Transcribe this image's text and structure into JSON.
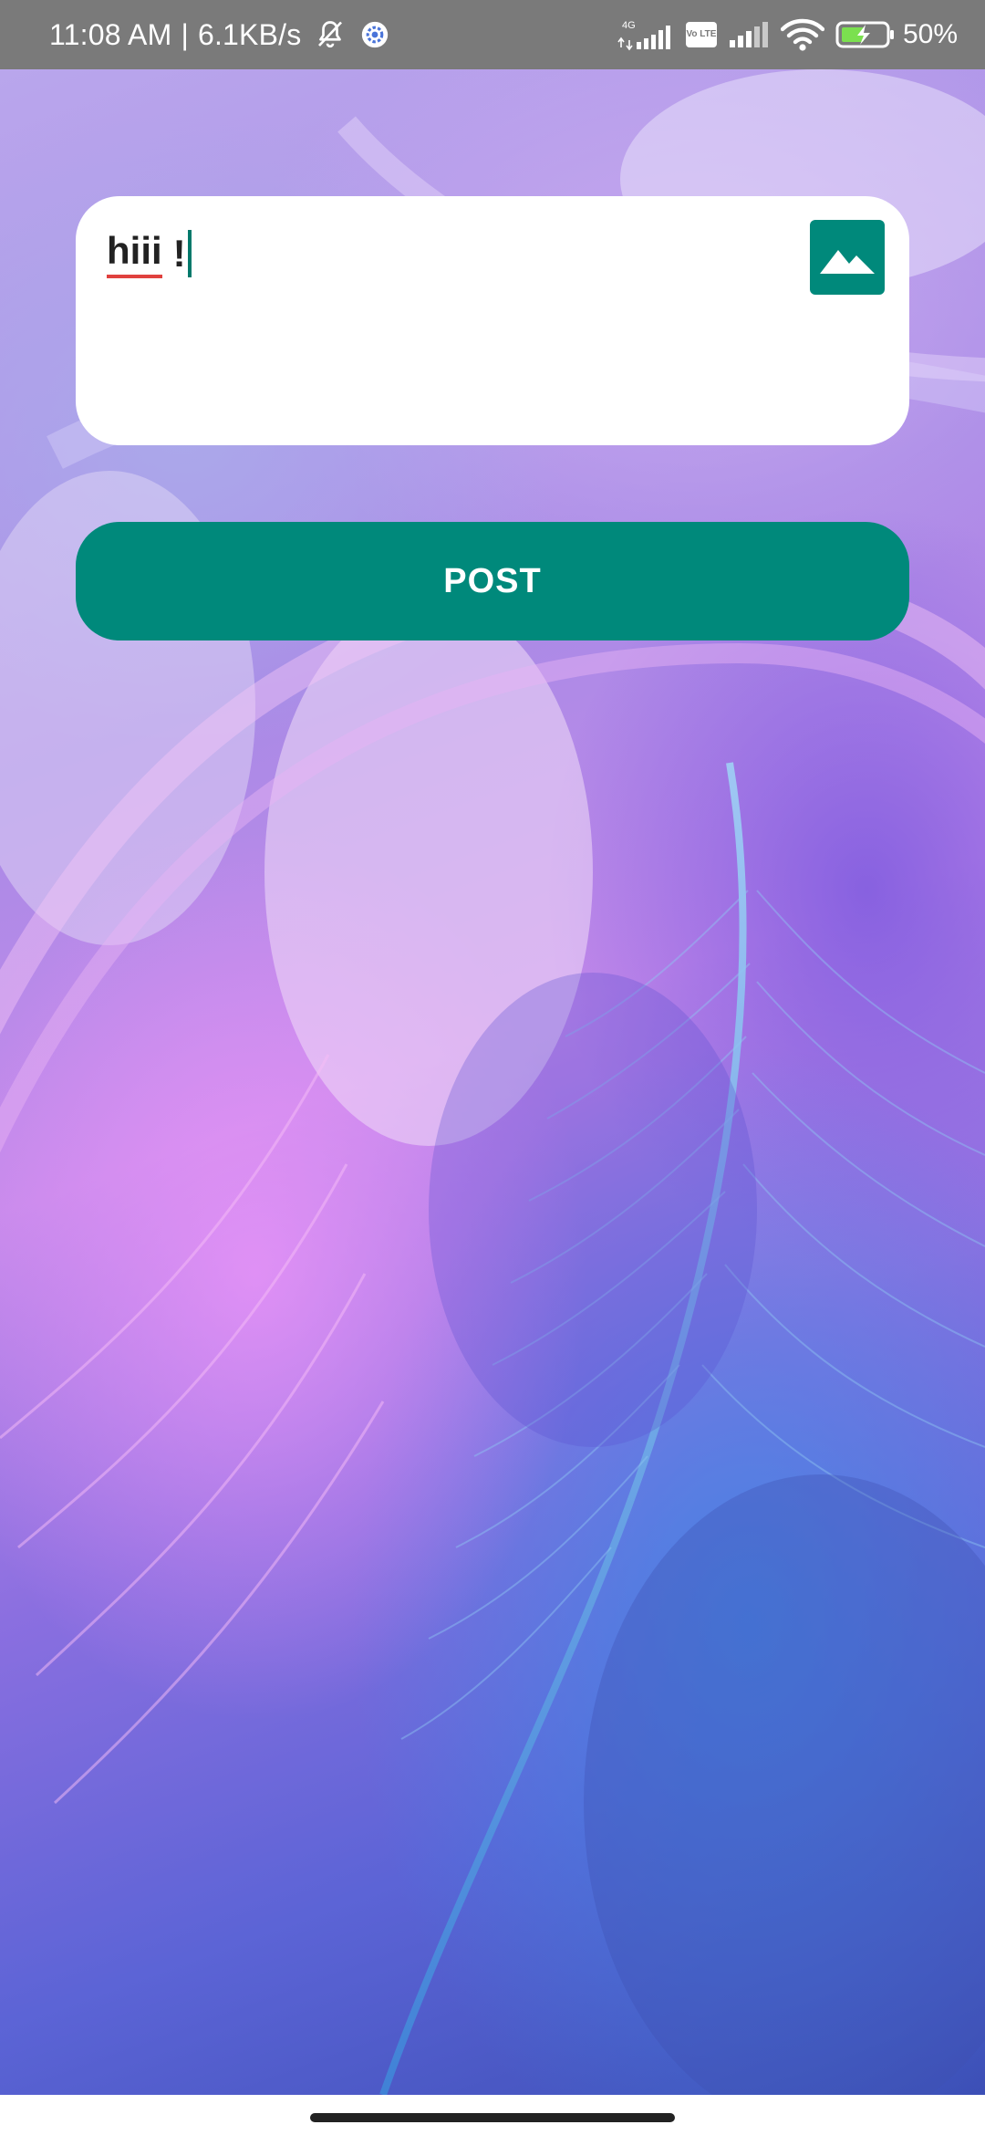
{
  "status_bar": {
    "time": "11:08 AM",
    "separator": "|",
    "net_speed": "6.1KB/s",
    "network_type": "4G",
    "volte_label": "Vo LTE",
    "battery_percent": "50%",
    "icons": [
      "bell-off-icon",
      "settings-gear-icon",
      "signal-icon",
      "wifi-icon",
      "battery-charging-icon"
    ]
  },
  "composer": {
    "text_word": "hiii",
    "text_rest": "!",
    "image_button_icon": "image-mountain-icon"
  },
  "post_button": {
    "label": "POST"
  },
  "colors": {
    "accent": "#00897b",
    "status_bar": "#7a7a7a",
    "spellcheck_underline": "#e0413e"
  }
}
